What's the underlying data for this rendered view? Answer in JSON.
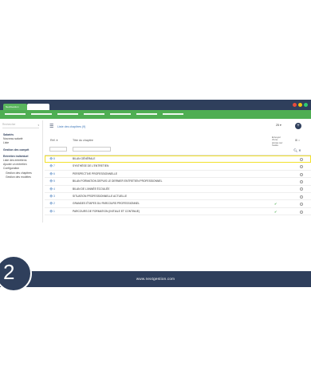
{
  "app": {
    "brand": "NextGestion",
    "window_dots": [
      "#e74c3c",
      "#f1c40f",
      "#2ecc71"
    ]
  },
  "sidebar": {
    "search_placeholder": "Rechercher",
    "lines": [
      {
        "text": "Salariés",
        "style": "head"
      },
      {
        "text": "Nouveau salarié",
        "style": "item"
      },
      {
        "text": "Liste",
        "style": "item"
      },
      {
        "text": "Gestion des compét",
        "style": "head"
      },
      {
        "text": "Entretien individuel",
        "style": "head"
      },
      {
        "text": "Liste des entretiens",
        "style": "item"
      },
      {
        "text": "Ajouter un entretien",
        "style": "item"
      },
      {
        "text": "Configuration",
        "style": "item"
      },
      {
        "text": "Gestion des chapitres",
        "style": "sub"
      },
      {
        "text": "Gestion des modèles",
        "style": "sub"
      }
    ]
  },
  "main": {
    "title": "Liste des chapitres (9)",
    "page_size": "25 ▾",
    "add_label": "+",
    "columns": {
      "ref": "Réf. ▾",
      "title": "Titre du chapitre",
      "send": "Envoyer d'une année sur l'autre"
    },
    "rows": [
      {
        "ref": "8",
        "title": "BILAN GÉNÉRALE",
        "check": "",
        "selected": true
      },
      {
        "ref": "7",
        "title": "SYNTHÈSE DE L'ENTRETIEN",
        "check": "",
        "selected": false
      },
      {
        "ref": "6",
        "title": "PERSPECTIVE PROFESSIONNELLE",
        "check": "",
        "selected": false
      },
      {
        "ref": "5",
        "title": "BILAN FORMATION DEPUIS LE DERNIER ENTRETIEN PROFESSIONNEL",
        "check": "",
        "selected": false
      },
      {
        "ref": "4",
        "title": "BILAN DE L'ANNÉE ÉCOULÉE",
        "check": "",
        "selected": false
      },
      {
        "ref": "3",
        "title": "SITUATION PROFESSIONNELLE ACTUELLE",
        "check": "",
        "selected": false
      },
      {
        "ref": "2",
        "title": "GRANDES ÉTAPES DU PARCOURS PROFESSIONNEL",
        "check": "✔",
        "selected": false
      },
      {
        "ref": "1",
        "title": "PARCOURS DE FORMATION (INITIALE ET CONTINUE)",
        "check": "✔",
        "selected": false
      }
    ]
  },
  "footer": {
    "url": "www.nextgestion.com",
    "step": "2"
  }
}
